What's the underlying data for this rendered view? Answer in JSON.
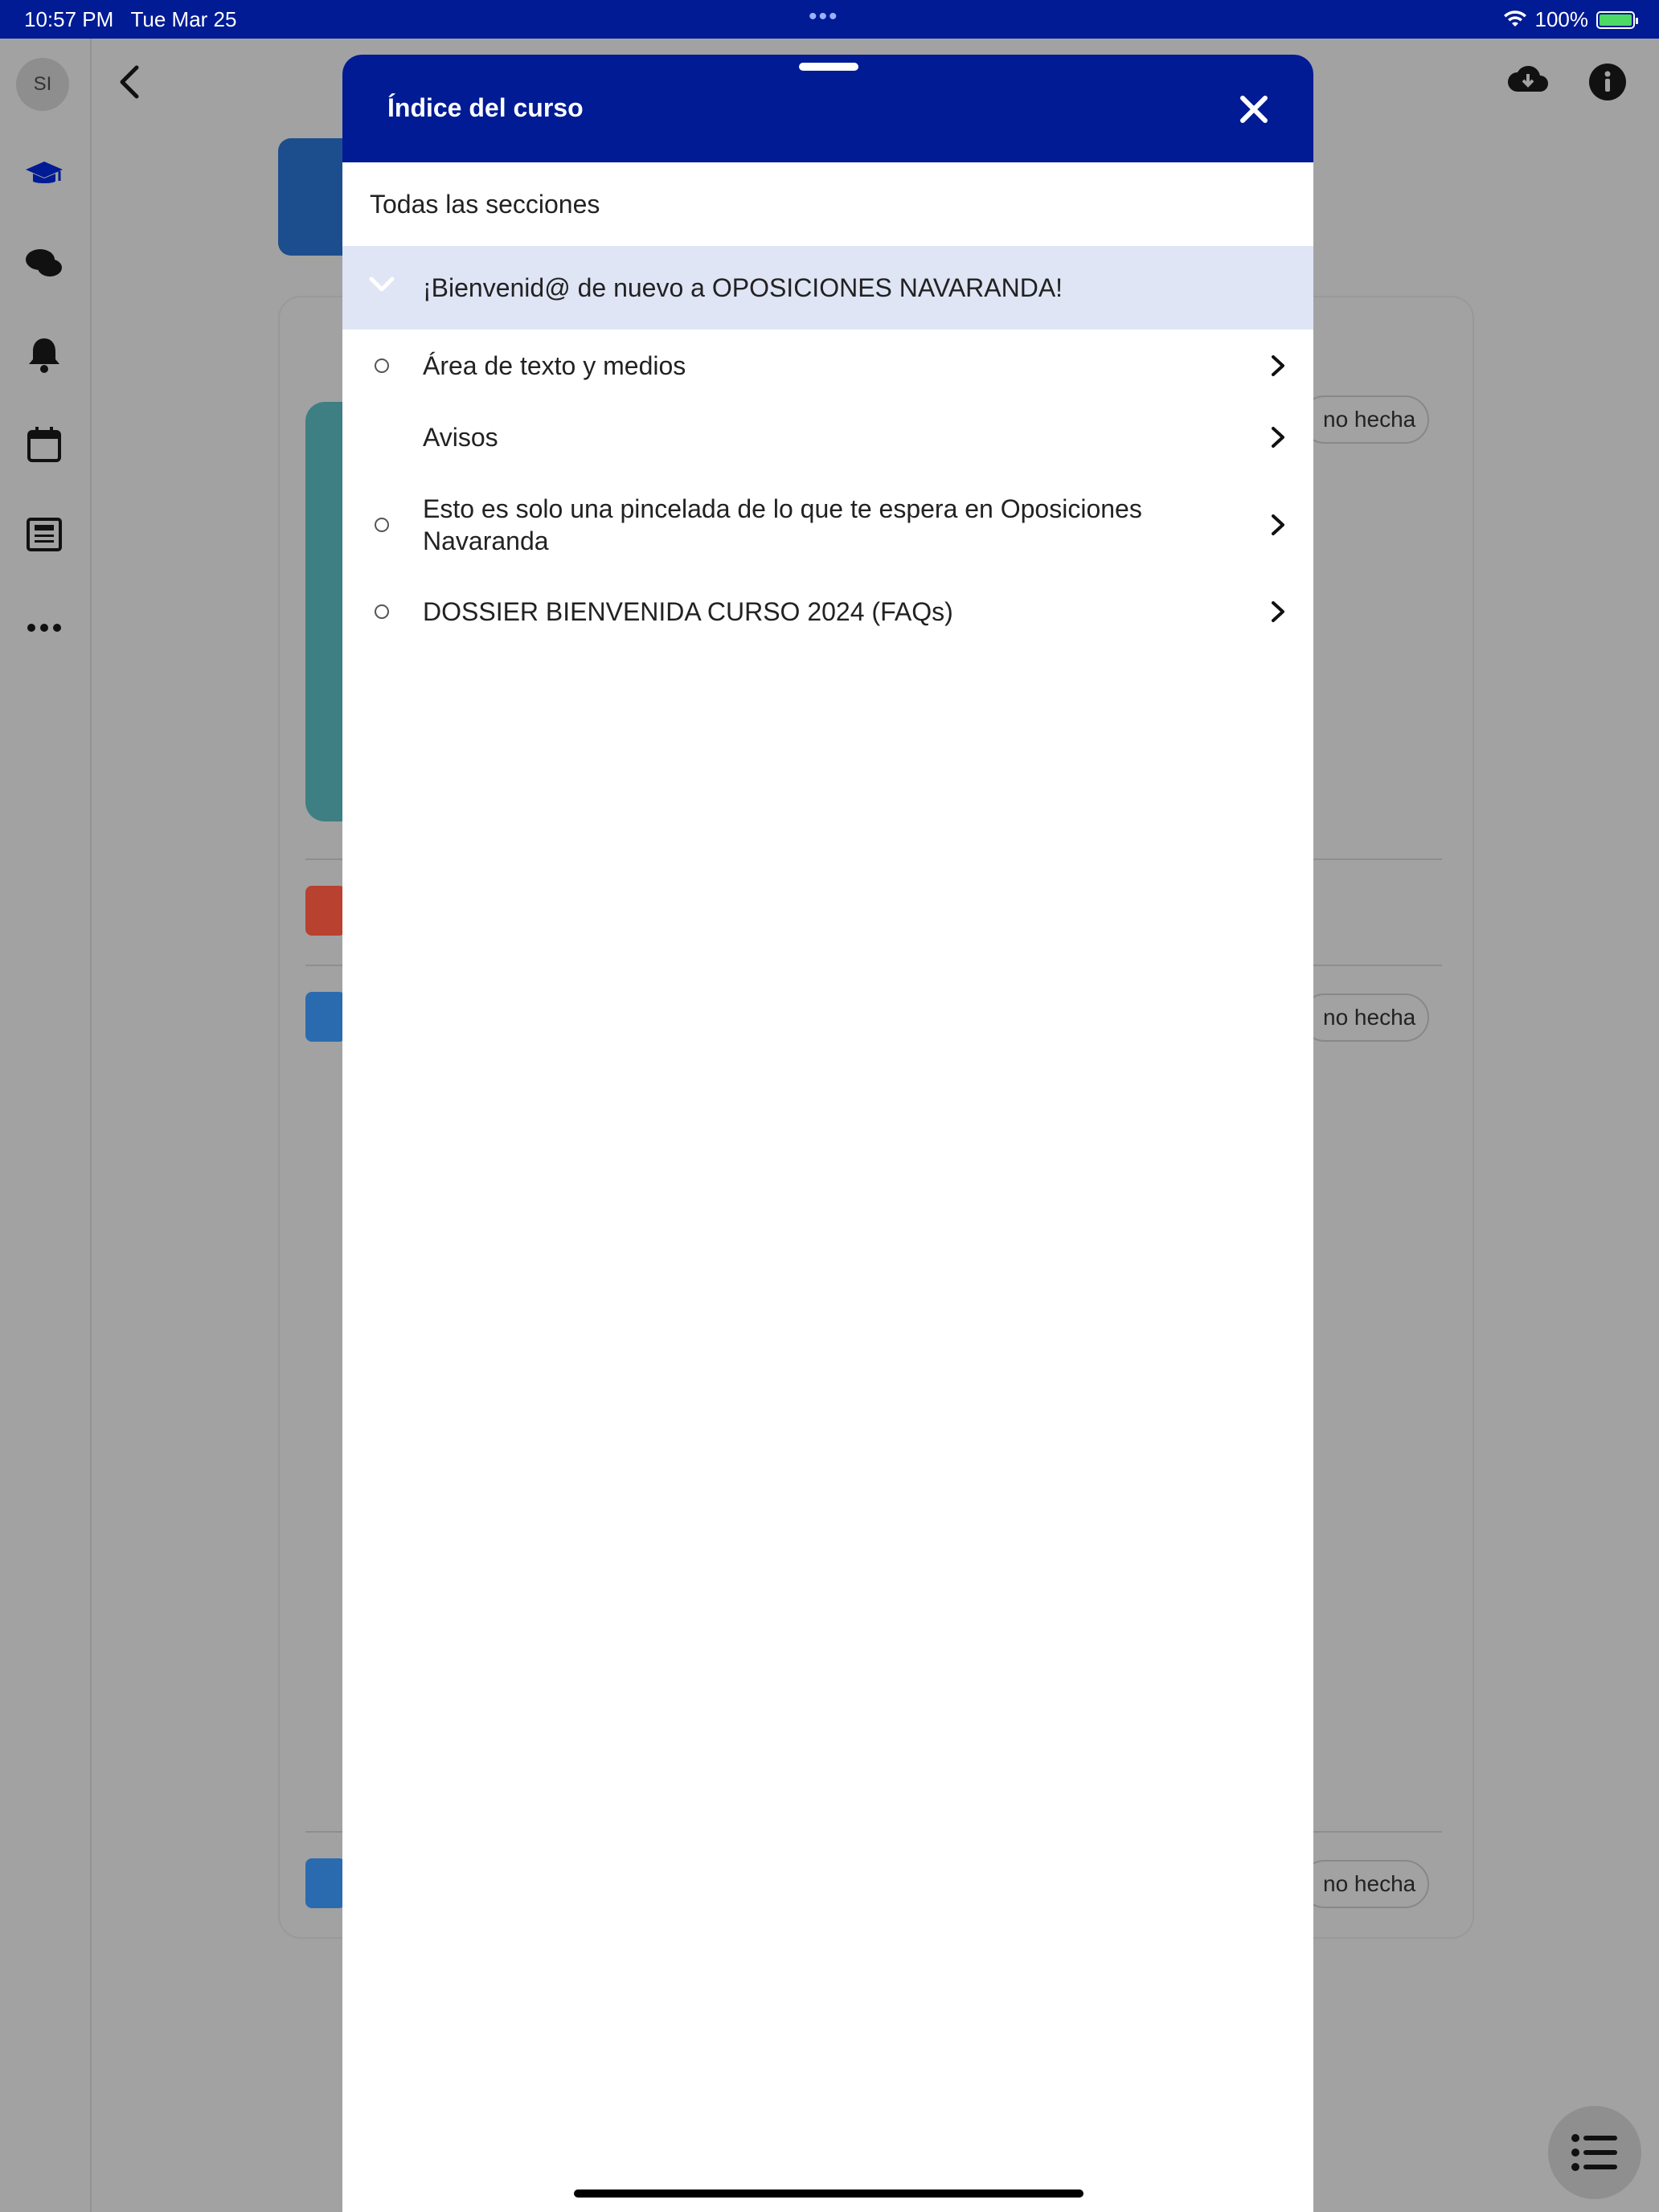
{
  "status_bar": {
    "time": "10:57 PM",
    "date": "Tue Mar 25",
    "battery": "100%"
  },
  "sidebar": {
    "avatar": "SI"
  },
  "background": {
    "pill_label": "no hecha"
  },
  "sheet": {
    "title": "Índice del curso",
    "all_sections": "Todas las secciones",
    "section_title": "¡Bienvenid@ de nuevo a OPOSICIONES NAVARANDA!",
    "items": [
      {
        "label": "Área de texto y medios"
      },
      {
        "label": "Avisos"
      },
      {
        "label": "Esto es solo una pincelada de lo que te espera en Oposiciones Navaranda"
      },
      {
        "label": "DOSSIER BIENVENIDA CURSO 2024 (FAQs)"
      }
    ]
  },
  "colors": {
    "header": "#001b94",
    "section_highlight": "#dfe5f5"
  }
}
